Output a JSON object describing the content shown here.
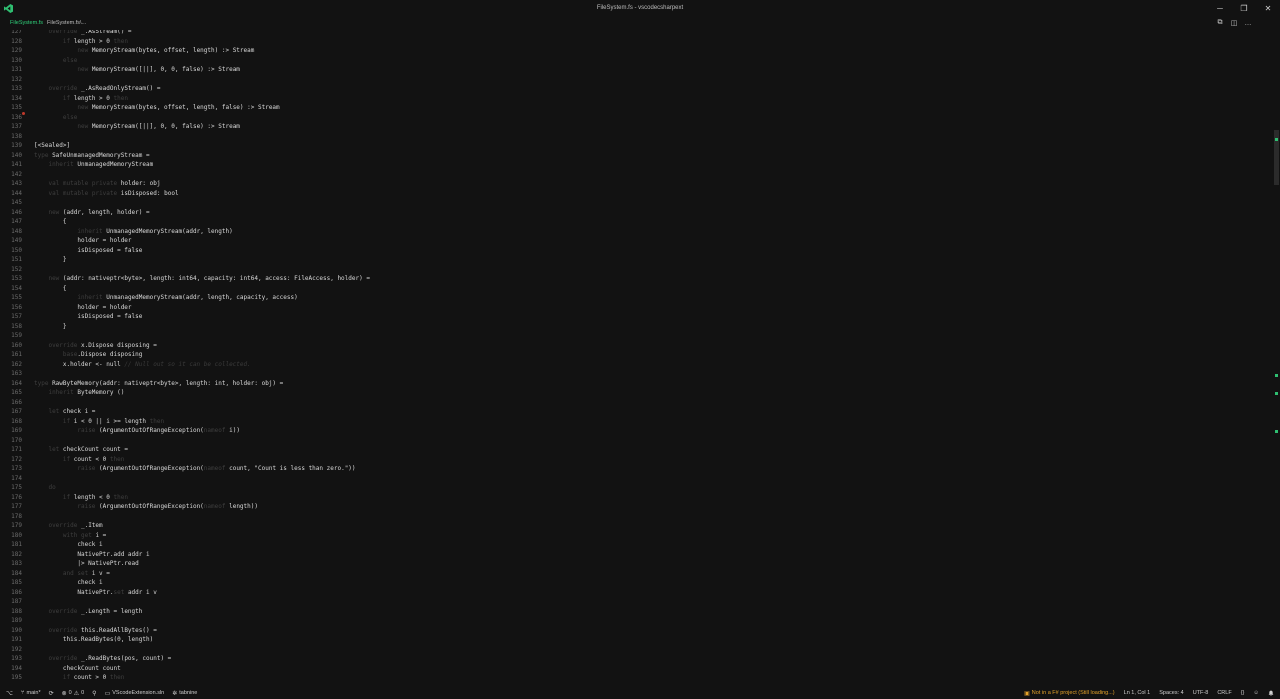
{
  "titlebar": {
    "title": "FileSystem.fs - vscodecsharpext",
    "logo_icon": "vscode-icon",
    "minimize": "─",
    "restore": "❐",
    "close": "✕"
  },
  "tabs": {
    "active": "FileSystem.fs",
    "breadcrumb": "FileSystem.fs\\..."
  },
  "editor_actions": [
    "⧉",
    "◫",
    "…"
  ],
  "code_lines": [
    {
      "n": "127",
      "t": "    override _.AsStream() ="
    },
    {
      "n": "128",
      "t": "        if length > 0 then"
    },
    {
      "n": "129",
      "t": "            new MemoryStream(bytes, offset, length) :> Stream"
    },
    {
      "n": "130",
      "t": "        else"
    },
    {
      "n": "131",
      "t": "            new MemoryStream([||], 0, 0, false) :> Stream"
    },
    {
      "n": "132",
      "t": ""
    },
    {
      "n": "133",
      "t": "    override _.AsReadOnlyStream() ="
    },
    {
      "n": "134",
      "t": "        if length > 0 then"
    },
    {
      "n": "135",
      "t": "            new MemoryStream(bytes, offset, length, false) :> Stream"
    },
    {
      "n": "136",
      "t": "        else"
    },
    {
      "n": "137",
      "t": "            new MemoryStream([||], 0, 0, false) :> Stream"
    },
    {
      "n": "138",
      "t": ""
    },
    {
      "n": "139",
      "t": "[<Sealed>]"
    },
    {
      "n": "140",
      "t": "type SafeUnmanagedMemoryStream ="
    },
    {
      "n": "141",
      "t": "    inherit UnmanagedMemoryStream"
    },
    {
      "n": "142",
      "t": ""
    },
    {
      "n": "143",
      "t": "    val mutable private holder: obj"
    },
    {
      "n": "144",
      "t": "    val mutable private isDisposed: bool"
    },
    {
      "n": "145",
      "t": ""
    },
    {
      "n": "146",
      "t": "    new (addr, length, holder) ="
    },
    {
      "n": "147",
      "t": "        {"
    },
    {
      "n": "148",
      "t": "            inherit UnmanagedMemoryStream(addr, length)"
    },
    {
      "n": "149",
      "t": "            holder = holder"
    },
    {
      "n": "150",
      "t": "            isDisposed = false"
    },
    {
      "n": "151",
      "t": "        }"
    },
    {
      "n": "152",
      "t": ""
    },
    {
      "n": "153",
      "t": "    new (addr: nativeptr<byte>, length: int64, capacity: int64, access: FileAccess, holder) ="
    },
    {
      "n": "154",
      "t": "        {"
    },
    {
      "n": "155",
      "t": "            inherit UnmanagedMemoryStream(addr, length, capacity, access)"
    },
    {
      "n": "156",
      "t": "            holder = holder"
    },
    {
      "n": "157",
      "t": "            isDisposed = false"
    },
    {
      "n": "158",
      "t": "        }"
    },
    {
      "n": "159",
      "t": ""
    },
    {
      "n": "160",
      "t": "    override x.Dispose disposing ="
    },
    {
      "n": "161",
      "t": "        base.Dispose disposing"
    },
    {
      "n": "162",
      "t": "        x.holder <- null // Null out so it can be collected."
    },
    {
      "n": "163",
      "t": ""
    },
    {
      "n": "164",
      "t": "type RawByteMemory(addr: nativeptr<byte>, length: int, holder: obj) ="
    },
    {
      "n": "165",
      "t": "    inherit ByteMemory ()"
    },
    {
      "n": "166",
      "t": ""
    },
    {
      "n": "167",
      "t": "    let check i ="
    },
    {
      "n": "168",
      "t": "        if i < 0 || i >= length then"
    },
    {
      "n": "169",
      "t": "            raise (ArgumentOutOfRangeException(nameof i))"
    },
    {
      "n": "170",
      "t": ""
    },
    {
      "n": "171",
      "t": "    let checkCount count ="
    },
    {
      "n": "172",
      "t": "        if count < 0 then"
    },
    {
      "n": "173",
      "t": "            raise (ArgumentOutOfRangeException(nameof count, \"Count is less than zero.\"))"
    },
    {
      "n": "174",
      "t": ""
    },
    {
      "n": "175",
      "t": "    do"
    },
    {
      "n": "176",
      "t": "        if length < 0 then"
    },
    {
      "n": "177",
      "t": "            raise (ArgumentOutOfRangeException(nameof length))"
    },
    {
      "n": "178",
      "t": ""
    },
    {
      "n": "179",
      "t": "    override _.Item"
    },
    {
      "n": "180",
      "t": "        with get i ="
    },
    {
      "n": "181",
      "t": "            check i"
    },
    {
      "n": "182",
      "t": "            NativePtr.add addr i"
    },
    {
      "n": "183",
      "t": "            |> NativePtr.read"
    },
    {
      "n": "184",
      "t": "        and set i v ="
    },
    {
      "n": "185",
      "t": "            check i"
    },
    {
      "n": "186",
      "t": "            NativePtr.set addr i v"
    },
    {
      "n": "187",
      "t": ""
    },
    {
      "n": "188",
      "t": "    override _.Length = length"
    },
    {
      "n": "189",
      "t": ""
    },
    {
      "n": "190",
      "t": "    override this.ReadAllBytes() ="
    },
    {
      "n": "191",
      "t": "        this.ReadBytes(0, length)"
    },
    {
      "n": "192",
      "t": ""
    },
    {
      "n": "193",
      "t": "    override _.ReadBytes(pos, count) ="
    },
    {
      "n": "194",
      "t": "        checkCount count"
    },
    {
      "n": "195",
      "t": "        if count > 0 then"
    }
  ],
  "status": {
    "branch": "main*",
    "sync": "⟳",
    "errors": "0",
    "warnings": "0",
    "debug": "⚲",
    "solution": "VScodeExtension.sln",
    "tabnine": "tabnine",
    "project": "Not in a F# project (Still loading...)",
    "cursor": "Ln 1, Col 1",
    "spaces": "Spaces: 4",
    "encoding": "UTF-8",
    "eol": "CRLF",
    "language_icon": "{}",
    "feedback_icon": "☺",
    "bell_icon": "🔔"
  },
  "colors": {
    "accent_green": "#2fd17a",
    "warning": "#e5a32a",
    "background": "#121212"
  }
}
